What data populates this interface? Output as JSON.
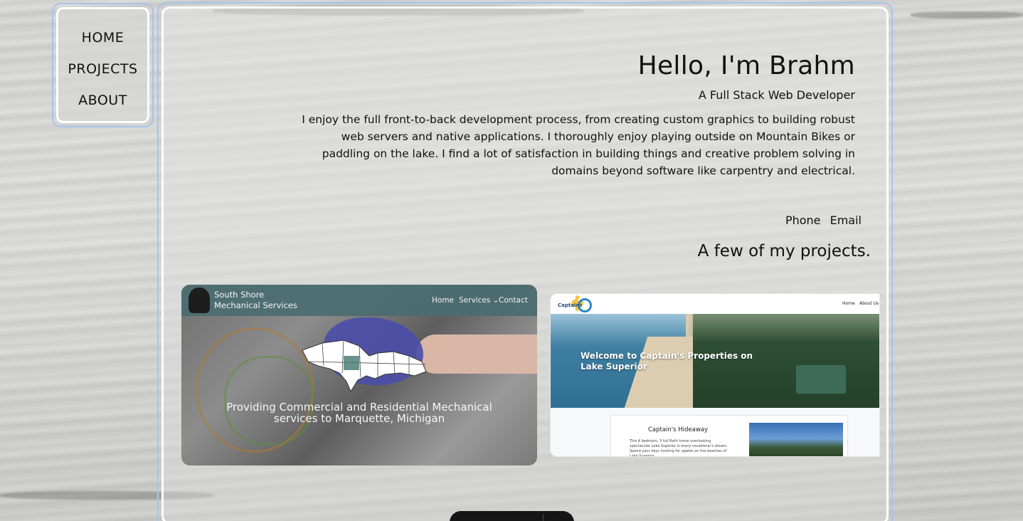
{
  "nav": {
    "items": [
      {
        "label": "HOME"
      },
      {
        "label": "PROJECTS"
      },
      {
        "label": "ABOUT"
      }
    ]
  },
  "hero": {
    "greeting": "Hello, I'm Brahm",
    "subtitle": "A Full Stack Web Developer",
    "bio": "I enjoy the full front-to-back development process, from creating custom graphics to building robust web servers and native applications. I thoroughly enjoy playing outside on Mountain Bikes or paddling on the lake. I find a lot of satisfaction in building things and creative problem solving in domains beyond software like carpentry and electrical."
  },
  "contact": {
    "phone_label": "Phone",
    "email_label": "Email"
  },
  "projects": {
    "heading": "A few of my  projects.",
    "cards": [
      {
        "brand_line1": "South Shore",
        "brand_line2": "Mechanical Services",
        "menu": [
          "Home",
          "Services ⌄",
          "Contact"
        ],
        "tagline_line1": "Providing Commercial and Residential Mechanical",
        "tagline_line2": "services to Marquette, Michigan"
      },
      {
        "logo_text": "Captains",
        "menu": [
          "Home",
          "About Us"
        ],
        "hero_line1": "Welcome to Captain's Properties on",
        "hero_line2": "Lake Superior",
        "listing_title": "Captain's Hideaway",
        "listing_desc": "This 4 bedroom, 3 full Bath home overlooking spectacular Lake Superior is every vacationer's dream. Spend your days hunting for agates on the beaches of Lake Superior."
      }
    ]
  },
  "colors": {
    "frame_border": "#a9c3ea",
    "card1_bar": "#4b6c70",
    "text": "#111111"
  }
}
